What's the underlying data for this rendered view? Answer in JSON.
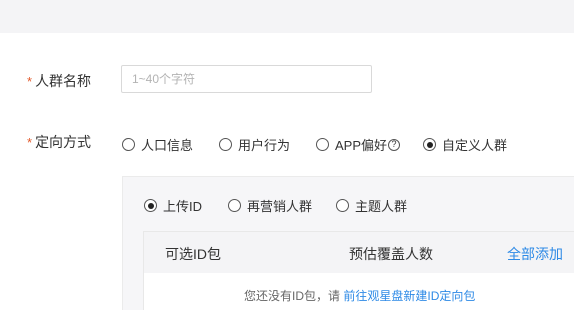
{
  "form": {
    "required_mark": "*",
    "name_label": "人群名称",
    "name_placeholder": "1~40个字符",
    "targeting_label": "定向方式"
  },
  "targeting_options": [
    {
      "label": "人口信息",
      "checked": false
    },
    {
      "label": "用户行为",
      "checked": false
    },
    {
      "label": "APP偏好",
      "checked": false,
      "help": "?"
    },
    {
      "label": "自定义人群",
      "checked": true
    }
  ],
  "source_options": [
    {
      "label": "上传ID",
      "checked": true
    },
    {
      "label": "再营销人群",
      "checked": false
    },
    {
      "label": "主题人群",
      "checked": false
    }
  ],
  "table": {
    "col1": "可选ID包",
    "col2": "预估覆盖人数",
    "add_all": "全部添加",
    "empty_text": "您还没有ID包，请",
    "empty_link": "前往观星盘新建ID定向包"
  }
}
